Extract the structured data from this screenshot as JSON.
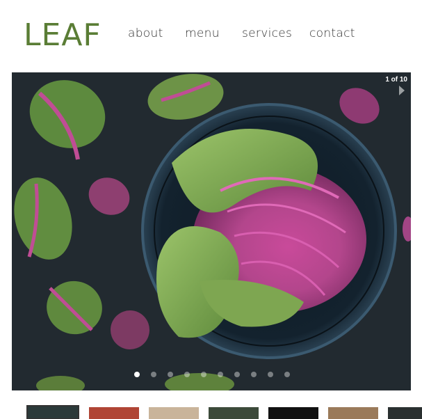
{
  "brand": {
    "logo_text": "LEAF",
    "color": "#5a7d35"
  },
  "nav": {
    "items": [
      {
        "label": "about"
      },
      {
        "label": "menu"
      },
      {
        "label": "services"
      },
      {
        "label": "contact"
      }
    ]
  },
  "slideshow": {
    "counter": "1 of 10",
    "current_index": 1,
    "total": 10,
    "image_subject": "purple cabbage in dark bowl",
    "next_icon": "chevron-right-icon"
  },
  "thumbnails": {
    "count": 7,
    "selected_index": 0,
    "colors": [
      "#2b3a3a",
      "#b04535",
      "#c9b49a",
      "#3c4a3a",
      "#111111",
      "#9a7a5a",
      "#2a3030"
    ]
  }
}
